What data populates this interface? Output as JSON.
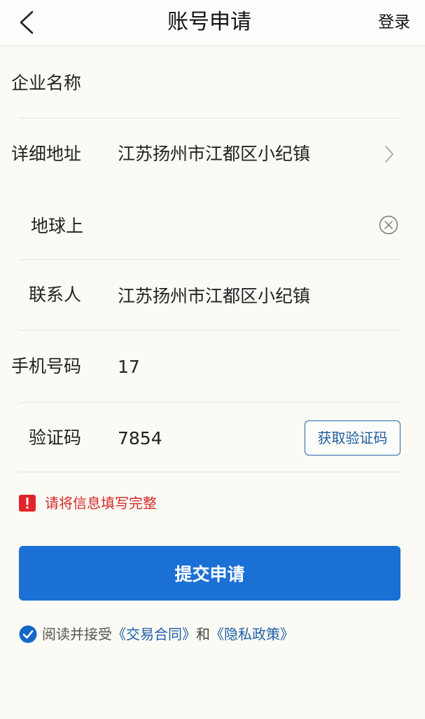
{
  "header": {
    "back_icon": "chevron-left-icon",
    "title": "账号申请",
    "login_label": "登录"
  },
  "form": {
    "company": {
      "label": "企业名称",
      "value": ""
    },
    "address": {
      "label": "详细地址",
      "value": "江苏扬州市江都区小纪镇",
      "icon": "chevron-right-icon"
    },
    "address_detail": {
      "value": "地球上",
      "clear_icon": "clear-icon"
    },
    "contact": {
      "label": "联系人",
      "value": "江苏扬州市江都区小纪镇"
    },
    "phone": {
      "label": "手机号码",
      "value": "17"
    },
    "code": {
      "label": "验证码",
      "value": "7854",
      "get_code_label": "获取验证码"
    }
  },
  "error": {
    "icon": "alert-icon",
    "message": "请将信息填写完整"
  },
  "submit_label": "提交申请",
  "agreement": {
    "checked": true,
    "check_icon": "check-circle-icon",
    "prefix": "阅读并接受",
    "contract_link": "《交易合同》",
    "conjunction": "和",
    "privacy_link": "《隐私政策》"
  },
  "colors": {
    "accent": "#1b70d6",
    "link": "#1d5fa8",
    "error": "#d42a2a",
    "background": "#fbfaf5"
  }
}
